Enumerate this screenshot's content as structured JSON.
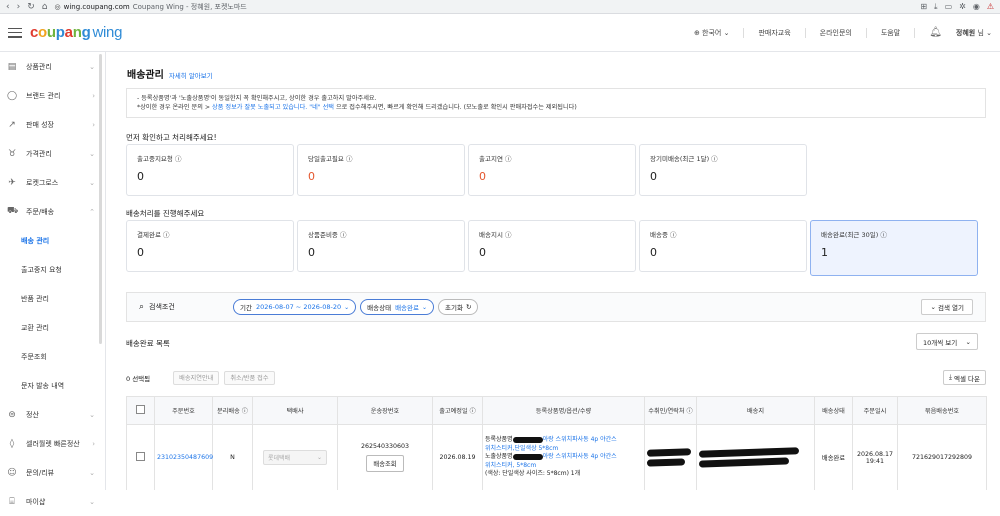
{
  "browser": {
    "url_host": "wing.coupang.com",
    "url_title": "Coupang Wing - 정혜원, 포켓노마드"
  },
  "header": {
    "logo_coupang": "coupang",
    "logo_wing": "wing",
    "language": "한국어",
    "links": [
      "판매자교육",
      "온라인문의",
      "도움말"
    ],
    "user_name": "정혜원",
    "user_suffix": "님"
  },
  "sidebar": {
    "items": [
      {
        "label": "상품관리",
        "icon": "box-icon"
      },
      {
        "label": "브랜드 관리",
        "icon": "shield-icon"
      },
      {
        "label": "판매 성장",
        "icon": "trend-icon"
      },
      {
        "label": "가격관리",
        "icon": "price-icon"
      },
      {
        "label": "로켓그로스",
        "icon": "rocket-icon"
      },
      {
        "label": "주문/배송",
        "icon": "truck-icon"
      }
    ],
    "subitems": [
      "배송 관리",
      "출고중지 요청",
      "반품 관리",
      "교환 관리",
      "주문조회",
      "문자 발송 내역"
    ],
    "items_bottom": [
      {
        "label": "정산",
        "icon": "won-icon"
      },
      {
        "label": "셀러월렛 빠른정산",
        "icon": "wallet-icon"
      },
      {
        "label": "문의/리뷰",
        "icon": "chat-icon"
      },
      {
        "label": "마이샵",
        "icon": "shop-icon"
      }
    ]
  },
  "page": {
    "title": "배송관리",
    "help_link": "자세히 알아보기",
    "notice_line1": "- 등록상품명'과 '노출상품명'이 동일한지 꼭 확인해주시고, 상이한 경우 출고하지 말아주세요.",
    "notice_line2_a": "*상이한 경우 온라인 문의 > ",
    "notice_line2_b": "상품 정보가 잘못 노출되고 있습니다. \"네\" 선택",
    "notice_line2_c": " 으로 접수해주시면, 빠르게 확인해 드리겠습니다. (모노출로 확인시 판매자접수는 제외됩니다)"
  },
  "section1": {
    "label": "먼저 확인하고 처리해주세요!",
    "cards": [
      {
        "label": "출고중지요청 ⓘ",
        "value": "0",
        "color": "#222222"
      },
      {
        "label": "당일출고필요 ⓘ",
        "value": "0",
        "color": "#e4572e"
      },
      {
        "label": "출고지연 ⓘ",
        "value": "0",
        "color": "#e4572e"
      },
      {
        "label": "장기미배송(최근 1달) ⓘ",
        "value": "0",
        "color": "#222222"
      }
    ]
  },
  "section2": {
    "label": "배송처리를 진행해주세요",
    "cards": [
      {
        "label": "결제완료 ⓘ",
        "value": "0"
      },
      {
        "label": "상품준비중 ⓘ",
        "value": "0"
      },
      {
        "label": "배송지시 ⓘ",
        "value": "0"
      },
      {
        "label": "배송중 ⓘ",
        "value": "0"
      },
      {
        "label": "배송완료(최근 30일) ⓘ",
        "value": "1"
      }
    ]
  },
  "search": {
    "label": "검색조건",
    "period_label": "기간",
    "period_value": "2026-08-07 ~ 2026-08-20",
    "status_label": "배송상태",
    "status_value": "배송완료",
    "reset": "초기화",
    "open": "검색 열기"
  },
  "list": {
    "title": "배송완료 목록",
    "per_page": "10개씩 보기",
    "selected": "0 선택됨",
    "btn_guide": "배송지연안내",
    "btn_cancel": "취소/반품 접수",
    "excel": "엑셀 다운"
  },
  "table": {
    "headers": [
      "",
      "주문번호",
      "분리배송 ⓘ",
      "택배사",
      "운송장번호",
      "출고예정일 ⓘ",
      "등록상품명/옵션/수량",
      "수취인/연락처 ⓘ",
      "배송지",
      "배송상태",
      "주문일시",
      "묶음배송번호"
    ],
    "row": {
      "order_no": "23102350487609",
      "split": "N",
      "courier": "롯데택배",
      "tracking": "262540330603",
      "track_btn": "배송조회",
      "ship_date": "2026.08.19",
      "prod_line1_prefix": "등록상품명",
      "prod_line1_link": "아랑 스위치파사동 4p 야간스",
      "prod_line2": "위치스티커,단일색상 5*8cm",
      "prod_line3_prefix": "노출상품명",
      "prod_line3_link": "아랑 스위치파사동 4p 야간스",
      "prod_line4": "위치스티커, 5*8cm",
      "prod_line5": "(색상: 단일색상 사이즈: 5*8cm) 1개",
      "status": "배송완료",
      "order_time": "2026.08.17 19:41",
      "bundle_no": "721629017292809"
    }
  }
}
